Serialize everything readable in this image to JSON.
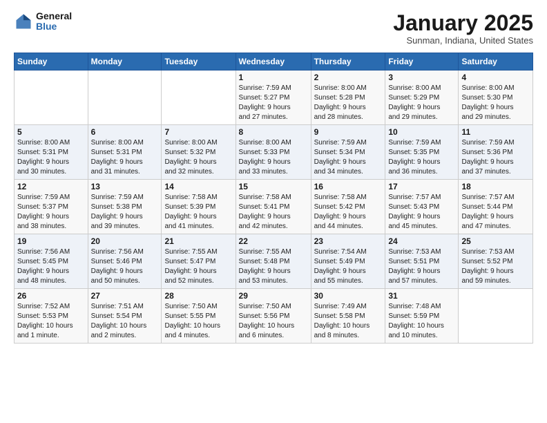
{
  "header": {
    "logo_general": "General",
    "logo_blue": "Blue",
    "month_title": "January 2025",
    "location": "Sunman, Indiana, United States"
  },
  "days_of_week": [
    "Sunday",
    "Monday",
    "Tuesday",
    "Wednesday",
    "Thursday",
    "Friday",
    "Saturday"
  ],
  "weeks": [
    [
      {
        "day": "",
        "info": ""
      },
      {
        "day": "",
        "info": ""
      },
      {
        "day": "",
        "info": ""
      },
      {
        "day": "1",
        "info": "Sunrise: 7:59 AM\nSunset: 5:27 PM\nDaylight: 9 hours\nand 27 minutes."
      },
      {
        "day": "2",
        "info": "Sunrise: 8:00 AM\nSunset: 5:28 PM\nDaylight: 9 hours\nand 28 minutes."
      },
      {
        "day": "3",
        "info": "Sunrise: 8:00 AM\nSunset: 5:29 PM\nDaylight: 9 hours\nand 29 minutes."
      },
      {
        "day": "4",
        "info": "Sunrise: 8:00 AM\nSunset: 5:30 PM\nDaylight: 9 hours\nand 29 minutes."
      }
    ],
    [
      {
        "day": "5",
        "info": "Sunrise: 8:00 AM\nSunset: 5:31 PM\nDaylight: 9 hours\nand 30 minutes."
      },
      {
        "day": "6",
        "info": "Sunrise: 8:00 AM\nSunset: 5:31 PM\nDaylight: 9 hours\nand 31 minutes."
      },
      {
        "day": "7",
        "info": "Sunrise: 8:00 AM\nSunset: 5:32 PM\nDaylight: 9 hours\nand 32 minutes."
      },
      {
        "day": "8",
        "info": "Sunrise: 8:00 AM\nSunset: 5:33 PM\nDaylight: 9 hours\nand 33 minutes."
      },
      {
        "day": "9",
        "info": "Sunrise: 7:59 AM\nSunset: 5:34 PM\nDaylight: 9 hours\nand 34 minutes."
      },
      {
        "day": "10",
        "info": "Sunrise: 7:59 AM\nSunset: 5:35 PM\nDaylight: 9 hours\nand 36 minutes."
      },
      {
        "day": "11",
        "info": "Sunrise: 7:59 AM\nSunset: 5:36 PM\nDaylight: 9 hours\nand 37 minutes."
      }
    ],
    [
      {
        "day": "12",
        "info": "Sunrise: 7:59 AM\nSunset: 5:37 PM\nDaylight: 9 hours\nand 38 minutes."
      },
      {
        "day": "13",
        "info": "Sunrise: 7:59 AM\nSunset: 5:38 PM\nDaylight: 9 hours\nand 39 minutes."
      },
      {
        "day": "14",
        "info": "Sunrise: 7:58 AM\nSunset: 5:39 PM\nDaylight: 9 hours\nand 41 minutes."
      },
      {
        "day": "15",
        "info": "Sunrise: 7:58 AM\nSunset: 5:41 PM\nDaylight: 9 hours\nand 42 minutes."
      },
      {
        "day": "16",
        "info": "Sunrise: 7:58 AM\nSunset: 5:42 PM\nDaylight: 9 hours\nand 44 minutes."
      },
      {
        "day": "17",
        "info": "Sunrise: 7:57 AM\nSunset: 5:43 PM\nDaylight: 9 hours\nand 45 minutes."
      },
      {
        "day": "18",
        "info": "Sunrise: 7:57 AM\nSunset: 5:44 PM\nDaylight: 9 hours\nand 47 minutes."
      }
    ],
    [
      {
        "day": "19",
        "info": "Sunrise: 7:56 AM\nSunset: 5:45 PM\nDaylight: 9 hours\nand 48 minutes."
      },
      {
        "day": "20",
        "info": "Sunrise: 7:56 AM\nSunset: 5:46 PM\nDaylight: 9 hours\nand 50 minutes."
      },
      {
        "day": "21",
        "info": "Sunrise: 7:55 AM\nSunset: 5:47 PM\nDaylight: 9 hours\nand 52 minutes."
      },
      {
        "day": "22",
        "info": "Sunrise: 7:55 AM\nSunset: 5:48 PM\nDaylight: 9 hours\nand 53 minutes."
      },
      {
        "day": "23",
        "info": "Sunrise: 7:54 AM\nSunset: 5:49 PM\nDaylight: 9 hours\nand 55 minutes."
      },
      {
        "day": "24",
        "info": "Sunrise: 7:53 AM\nSunset: 5:51 PM\nDaylight: 9 hours\nand 57 minutes."
      },
      {
        "day": "25",
        "info": "Sunrise: 7:53 AM\nSunset: 5:52 PM\nDaylight: 9 hours\nand 59 minutes."
      }
    ],
    [
      {
        "day": "26",
        "info": "Sunrise: 7:52 AM\nSunset: 5:53 PM\nDaylight: 10 hours\nand 1 minute."
      },
      {
        "day": "27",
        "info": "Sunrise: 7:51 AM\nSunset: 5:54 PM\nDaylight: 10 hours\nand 2 minutes."
      },
      {
        "day": "28",
        "info": "Sunrise: 7:50 AM\nSunset: 5:55 PM\nDaylight: 10 hours\nand 4 minutes."
      },
      {
        "day": "29",
        "info": "Sunrise: 7:50 AM\nSunset: 5:56 PM\nDaylight: 10 hours\nand 6 minutes."
      },
      {
        "day": "30",
        "info": "Sunrise: 7:49 AM\nSunset: 5:58 PM\nDaylight: 10 hours\nand 8 minutes."
      },
      {
        "day": "31",
        "info": "Sunrise: 7:48 AM\nSunset: 5:59 PM\nDaylight: 10 hours\nand 10 minutes."
      },
      {
        "day": "",
        "info": ""
      }
    ]
  ]
}
